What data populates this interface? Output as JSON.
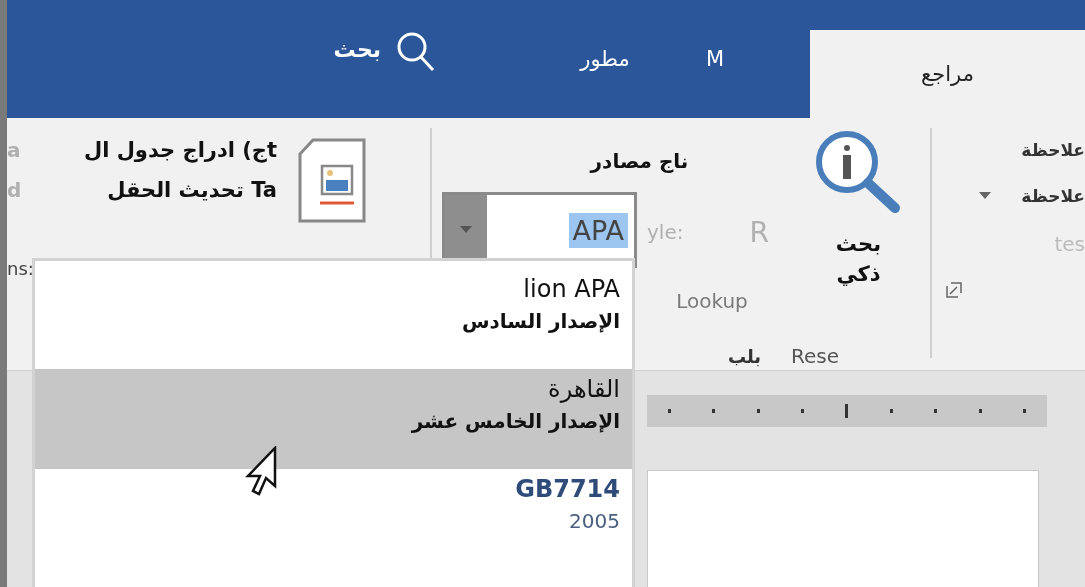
{
  "tabs": [
    {
      "label": "مراجع",
      "selected": true
    },
    {
      "label": "M",
      "selected": false
    },
    {
      "label": "مطور",
      "selected": false
    }
  ],
  "search": {
    "label": "بحث"
  },
  "ribbon": {
    "table_group": {
      "line_1": "ج) ادراج جدول الt",
      "line_2": "تحديث الحقل Ta",
      "edge_1": "a",
      "edge_2": "d",
      "edge_3": "ns:"
    },
    "research_group": {
      "manage_sources": "ناج مصادر",
      "style_label": "yle:",
      "style_value": "APA",
      "faint_letter": "R",
      "smart_lookup": [
        "بحث",
        "ذكي"
      ],
      "lookup_label": "Lookup",
      "group_label": "Rese",
      "group_label_arabic": "بلب"
    },
    "notes_group": {
      "items": [
        "علاحظة",
        "علاحظة"
      ],
      "group_label": "tes"
    }
  },
  "style_menu": {
    "items": [
      {
        "title": "lion APA",
        "subtitle": "الإصدار السادس",
        "selected": false,
        "kind": "text"
      },
      {
        "title": "القاهرة",
        "subtitle": "الإصدار الخامس عشر",
        "selected": true,
        "kind": "text"
      },
      {
        "title": "GB7714",
        "subtitle": "2005",
        "selected": false,
        "kind": "code"
      }
    ]
  }
}
